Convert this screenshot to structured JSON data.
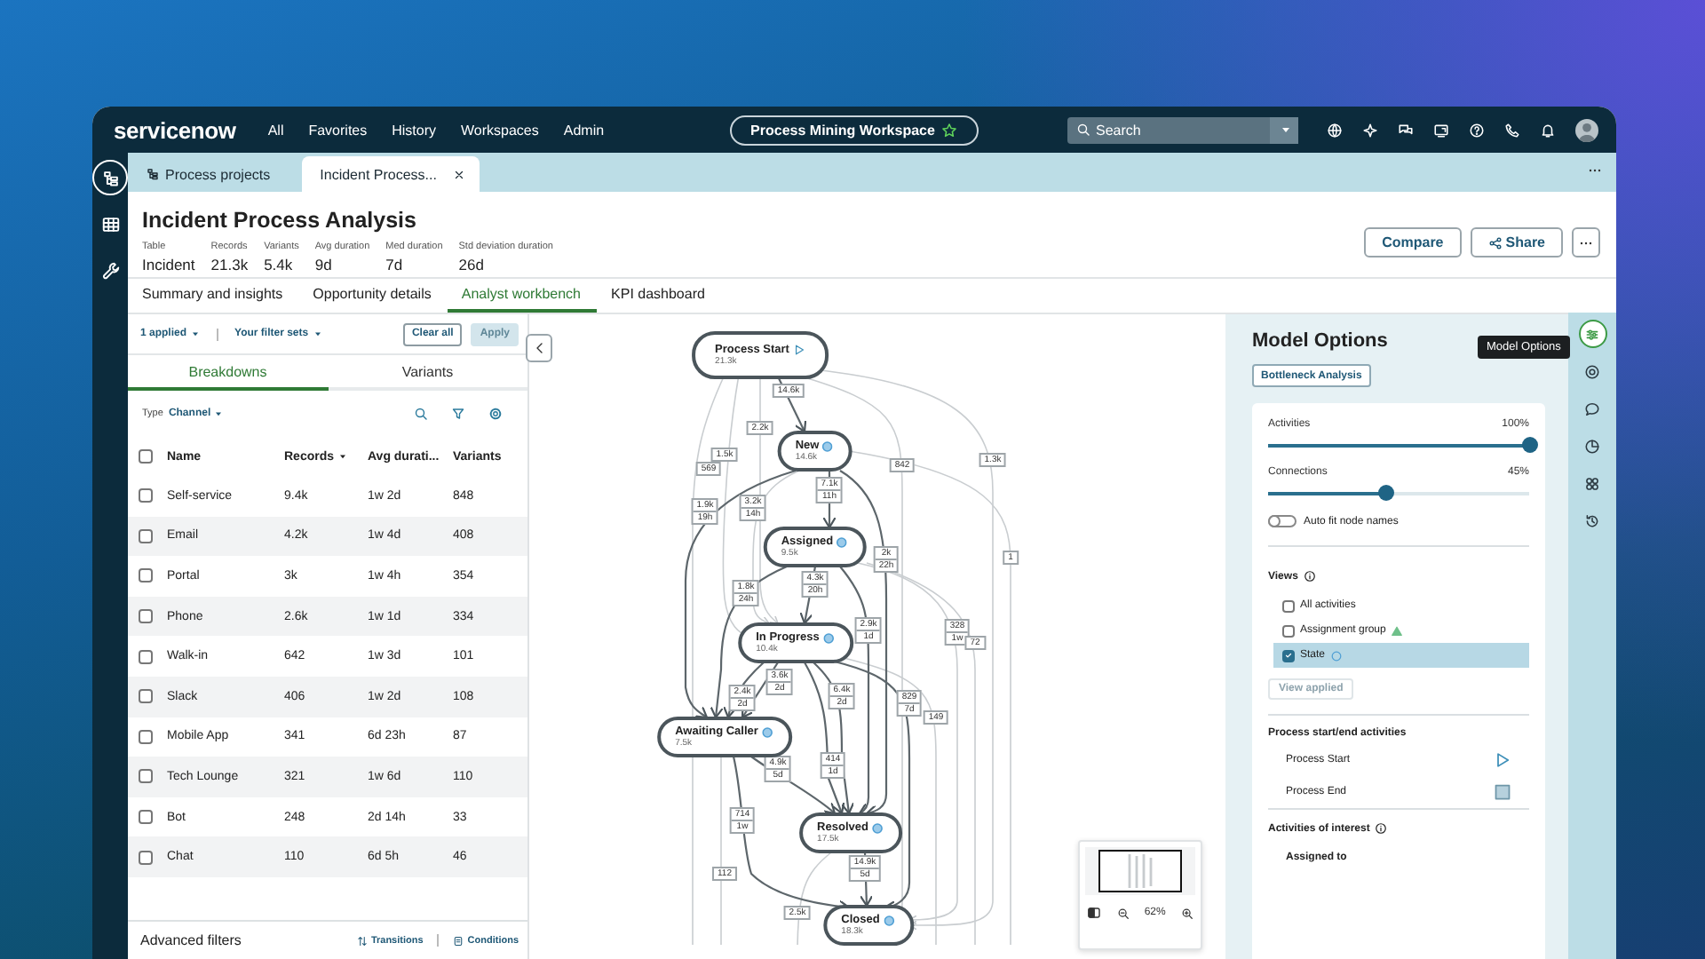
{
  "nav": {
    "logo": "servicenow",
    "links": [
      "All",
      "Favorites",
      "History",
      "Workspaces",
      "Admin"
    ],
    "workspace": "Process Mining Workspace",
    "search": {
      "placeholder": "Search"
    }
  },
  "left_rail": [
    {
      "selected": true
    },
    {
      "selected": false
    },
    {
      "selected": false
    }
  ],
  "tabs": [
    {
      "label": "Process projects",
      "selected": false
    },
    {
      "label": "Incident Process...",
      "selected": true
    }
  ],
  "header": {
    "title": "Incident Process Analysis",
    "stats": [
      {
        "label": "Table",
        "value": "Incident"
      },
      {
        "label": "Records",
        "value": "21.3k"
      },
      {
        "label": "Variants",
        "value": "5.4k"
      },
      {
        "label": "Avg duration",
        "value": "9d"
      },
      {
        "label": "Med duration",
        "value": "7d"
      },
      {
        "label": "Std deviation duration",
        "value": "26d"
      }
    ],
    "buttons": [
      "Compare",
      "Share"
    ]
  },
  "page_tabs": [
    {
      "label": "Summary and insights",
      "selected": false
    },
    {
      "label": "Opportunity details",
      "selected": false
    },
    {
      "label": "Analyst workbench",
      "selected": true
    },
    {
      "label": "KPI dashboard",
      "selected": false
    }
  ],
  "filters": {
    "applied": "1 applied",
    "filter_sets": "Your filter sets",
    "clear": "Clear all",
    "apply": {
      "label": "Apply",
      "disabled": true
    }
  },
  "breakdown_tabs": [
    {
      "label": "Breakdowns",
      "selected": true
    },
    {
      "label": "Variants",
      "selected": false
    }
  ],
  "type_filter": {
    "label": "Type",
    "value": "Channel"
  },
  "table": {
    "all_checked": false,
    "columns": [
      {
        "label": "Name",
        "sorted": false
      },
      {
        "label": "Records",
        "sorted": true
      },
      {
        "label": "Avg durati...",
        "sorted": false
      },
      {
        "label": "Variants",
        "sorted": false
      }
    ],
    "rows": [
      {
        "cells": [
          "Self-service",
          "9.4k",
          "1w 2d",
          "848"
        ],
        "checked": false
      },
      {
        "cells": [
          "Email",
          "4.2k",
          "1w 4d",
          "408"
        ],
        "checked": false
      },
      {
        "cells": [
          "Portal",
          "3k",
          "1w 4h",
          "354"
        ],
        "checked": false
      },
      {
        "cells": [
          "Phone",
          "2.6k",
          "1w 1d",
          "334"
        ],
        "checked": false
      },
      {
        "cells": [
          "Walk-in",
          "642",
          "1w 3d",
          "101"
        ],
        "checked": false
      },
      {
        "cells": [
          "Slack",
          "406",
          "1w 2d",
          "108"
        ],
        "checked": false
      },
      {
        "cells": [
          "Mobile App",
          "341",
          "6d 23h",
          "87"
        ],
        "checked": false
      },
      {
        "cells": [
          "Tech Lounge",
          "321",
          "1w 6d",
          "110"
        ],
        "checked": false
      },
      {
        "cells": [
          "Bot",
          "248",
          "2d 14h",
          "33"
        ],
        "checked": false
      },
      {
        "cells": [
          "Chat",
          "110",
          "6d 5h",
          "46"
        ],
        "checked": false
      }
    ]
  },
  "footer": {
    "title": "Advanced filters",
    "links": [
      "Transitions",
      "Conditions"
    ]
  },
  "graph": {
    "nodes": [
      {
        "name": "Process Start",
        "count": "21.3k",
        "kind": "start"
      },
      {
        "name": "New",
        "count": "14.6k",
        "kind": "state"
      },
      {
        "name": "Assigned",
        "count": "9.5k",
        "kind": "state"
      },
      {
        "name": "In Progress",
        "count": "10.4k",
        "kind": "state"
      },
      {
        "name": "Awaiting Caller",
        "count": "7.5k",
        "kind": "state"
      },
      {
        "name": "Resolved",
        "count": "17.5k",
        "kind": "state"
      },
      {
        "name": "Closed",
        "count": "18.3k",
        "kind": "state"
      }
    ],
    "edge_labels": [
      {
        "count": "14.6k"
      },
      {
        "count": "2.2k"
      },
      {
        "count": "1.5k"
      },
      {
        "count": "569"
      },
      {
        "count": "842"
      },
      {
        "count": "1.3k"
      },
      {
        "count": "1.9k",
        "duration": "19h"
      },
      {
        "count": "3.2k",
        "duration": "14h"
      },
      {
        "count": "7.1k",
        "duration": "11h"
      },
      {
        "count": "1"
      },
      {
        "count": "2k",
        "duration": "22h"
      },
      {
        "count": "4.3k",
        "duration": "20h"
      },
      {
        "count": "1.8k",
        "duration": "24h"
      },
      {
        "count": "2.9k",
        "duration": "1d"
      },
      {
        "count": "328",
        "duration": "1w"
      },
      {
        "count": "72"
      },
      {
        "count": "3.6k",
        "duration": "2d"
      },
      {
        "count": "2.4k",
        "duration": "2d"
      },
      {
        "count": "6.4k",
        "duration": "2d"
      },
      {
        "count": "829",
        "duration": "7d"
      },
      {
        "count": "149"
      },
      {
        "count": "4.9k",
        "duration": "5d"
      },
      {
        "count": "414",
        "duration": "1d"
      },
      {
        "count": "714",
        "duration": "1w"
      },
      {
        "count": "112"
      },
      {
        "count": "14.9k",
        "duration": "5d"
      },
      {
        "count": "2.5k"
      }
    ],
    "zoom": "62%"
  },
  "model_options": {
    "title": "Model Options",
    "mode": "Bottleneck Analysis",
    "sliders": [
      {
        "label": "Activities",
        "reading": "100%",
        "level": 1
      },
      {
        "label": "Connections",
        "reading": "45%",
        "level": 0.45
      }
    ],
    "auto_fit": {
      "label": "Auto fit node names",
      "on": false
    },
    "views": {
      "title": "Views",
      "items": [
        {
          "label": "All activities",
          "checked": false,
          "selected": false,
          "kind": "plain"
        },
        {
          "label": "Assignment group",
          "checked": false,
          "selected": false,
          "kind": "warning"
        },
        {
          "label": "State",
          "checked": true,
          "selected": true,
          "kind": "info"
        }
      ],
      "apply": {
        "label": "View applied",
        "disabled": true
      }
    },
    "start_end": {
      "title": "Process start/end activities",
      "items": [
        {
          "label": "Process Start",
          "kind": "start"
        },
        {
          "label": "Process End",
          "kind": "end"
        }
      ]
    },
    "interest": {
      "title": "Activities of interest",
      "items": [
        "Assigned to"
      ]
    }
  },
  "tooltip": "Model Options",
  "right_rail": [
    {
      "selected": true
    },
    {
      "selected": false
    },
    {
      "selected": false
    },
    {
      "selected": false
    },
    {
      "selected": false
    },
    {
      "selected": false
    }
  ]
}
